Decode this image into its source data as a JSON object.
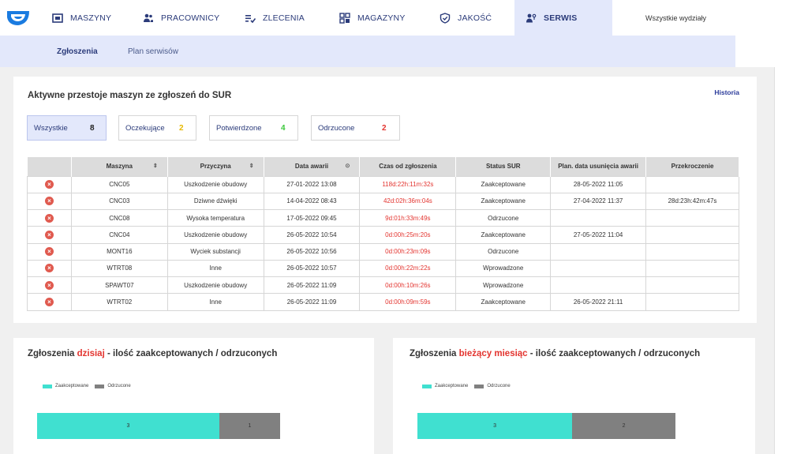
{
  "nav": {
    "items": [
      {
        "label": "MASZYNY",
        "icon": "machine-icon"
      },
      {
        "label": "PRACOWNICY",
        "icon": "people-icon"
      },
      {
        "label": "ZLECENIA",
        "icon": "checklist-icon"
      },
      {
        "label": "MAGAZYNY",
        "icon": "grid-icon"
      },
      {
        "label": "JAKOŚĆ",
        "icon": "shield-check-icon"
      },
      {
        "label": "SERWIS",
        "icon": "service-person-icon"
      }
    ],
    "active": "SERWIS",
    "department": "Wszystkie wydziały"
  },
  "subnav": {
    "items": [
      "Zgłoszenia",
      "Plan serwisów"
    ],
    "active": "Zgłoszenia"
  },
  "main": {
    "title": "Aktywne przestoje maszyn ze zgłoszeń do SUR",
    "history_link": "Historia",
    "filters": [
      {
        "label": "Wszystkie",
        "count": "8",
        "color": "#222222"
      },
      {
        "label": "Oczekujące",
        "count": "2",
        "color": "#e6b800"
      },
      {
        "label": "Potwierdzone",
        "count": "4",
        "color": "#3cc83c"
      },
      {
        "label": "Odrzucone",
        "count": "2",
        "color": "#e3342f"
      }
    ],
    "table": {
      "columns": [
        "",
        "Maszyna",
        "Przyczyna",
        "Data awarii",
        "Czas od zgłoszenia",
        "Status SUR",
        "Plan. data usunięcia awarii",
        "Przekroczenie"
      ],
      "rows": [
        [
          "CNC05",
          "Uszkodzenie obudowy",
          "27-01-2022 13:08",
          "118d:22h:11m:32s",
          "Zaakceptowane",
          "28-05-2022 11:05",
          ""
        ],
        [
          "CNC03",
          "Dziwne dźwięki",
          "14-04-2022 08:43",
          "42d:02h:36m:04s",
          "Zaakceptowane",
          "27-04-2022 11:37",
          "28d:23h:42m:47s"
        ],
        [
          "CNC08",
          "Wysoka temperatura",
          "17-05-2022 09:45",
          "9d:01h:33m:49s",
          "Odrzucone",
          "",
          ""
        ],
        [
          "CNC04",
          "Uszkodzenie obudowy",
          "26-05-2022 10:54",
          "0d:00h:25m:20s",
          "Zaakceptowane",
          "27-05-2022 11:04",
          ""
        ],
        [
          "MONT16",
          "Wyciek substancji",
          "26-05-2022 10:56",
          "0d:00h:23m:09s",
          "Odrzucone",
          "",
          ""
        ],
        [
          "WTRT08",
          "Inne",
          "26-05-2022 10:57",
          "0d:00h:22m:22s",
          "Wprowadzone",
          "",
          ""
        ],
        [
          "SPAWT07",
          "Uszkodzenie obudowy",
          "26-05-2022 11:09",
          "0d:00h:10m:26s",
          "Wprowadzone",
          "",
          ""
        ],
        [
          "WTRT02",
          "Inne",
          "26-05-2022 11:09",
          "0d:00h:09m:59s",
          "Zaakceptowane",
          "26-05-2022 21:11",
          ""
        ]
      ]
    }
  },
  "charts": [
    {
      "title_prefix": "Zgłoszenia ",
      "title_highlight": "dzisiaj",
      "title_suffix": " - ilość zaakceptowanych / odrzuconych",
      "legend": [
        "Zaakceptowane",
        "Odrzucone"
      ]
    },
    {
      "title_prefix": "Zgłoszenia ",
      "title_highlight": "bieżący miesiąc",
      "title_suffix": " - ilość zaakceptowanych / odrzuconych",
      "legend": [
        "Zaakceptowane",
        "Odrzucone"
      ]
    }
  ],
  "colors": {
    "accepted": "#40e0d0",
    "rejected": "#808080",
    "accent": "#2b3b7a",
    "alert": "#e3342f"
  },
  "chart_data": [
    {
      "type": "bar",
      "stacked": true,
      "orientation": "horizontal",
      "series": [
        {
          "name": "Zaakceptowane",
          "values": [
            3
          ]
        },
        {
          "name": "Odrzucone",
          "values": [
            1
          ]
        }
      ],
      "legend": "top-left"
    },
    {
      "type": "bar",
      "stacked": true,
      "orientation": "horizontal",
      "series": [
        {
          "name": "Zaakceptowane",
          "values": [
            3
          ]
        },
        {
          "name": "Odrzucone",
          "values": [
            2
          ]
        }
      ],
      "legend": "top-left"
    }
  ]
}
